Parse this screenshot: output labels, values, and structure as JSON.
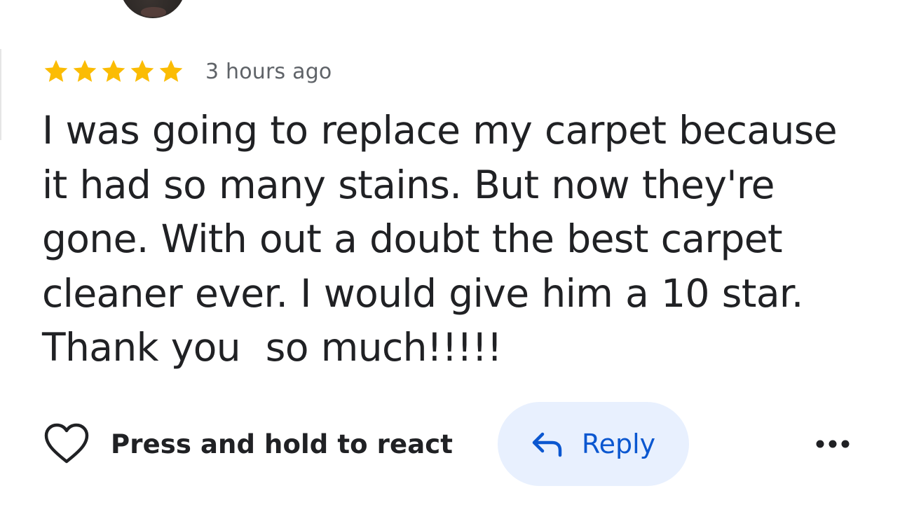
{
  "review": {
    "rating": 5,
    "rating_max": 5,
    "time_ago": "3 hours ago",
    "text": "I was going to replace my carpet because it had so many stains. But now they're gone. With out a doubt the best carpet cleaner ever. I would give him a 10 star. Thank you  so much!!!!!"
  },
  "actions": {
    "react_label": "Press and hold to react",
    "reply_label": "Reply"
  },
  "icons": {
    "star": "star-icon",
    "heart": "heart-outline-icon",
    "reply": "reply-arrow-icon",
    "more": "more-horizontal-icon"
  },
  "colors": {
    "star": "#FBBC04",
    "reply_bg": "#E8F0FE",
    "reply_fg": "#0B57D0",
    "text": "#202124",
    "muted": "#5F6368"
  }
}
